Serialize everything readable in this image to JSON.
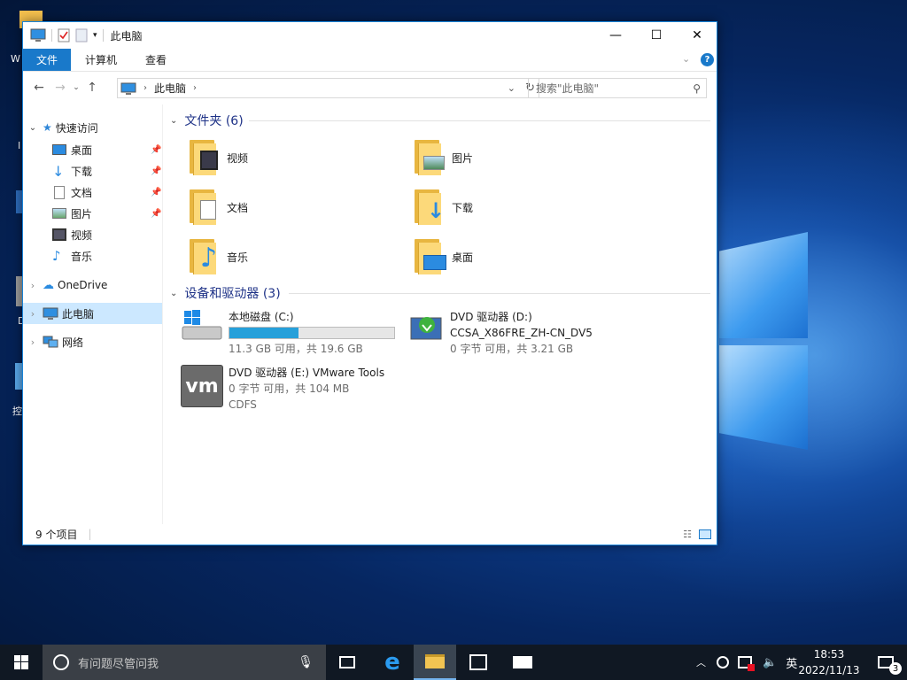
{
  "window": {
    "title": "此电脑",
    "min_glyph": "—",
    "max_glyph": "☐",
    "close_glyph": "✕"
  },
  "ribbon": {
    "tabs": [
      "文件",
      "计算机",
      "查看"
    ]
  },
  "address": {
    "path": "此电脑",
    "search_placeholder": "搜索\"此电脑\""
  },
  "sidebar": {
    "quick_access": "快速访问",
    "pinned": [
      "桌面",
      "下载",
      "文档",
      "图片"
    ],
    "unpinned": [
      "视频",
      "音乐"
    ],
    "onedrive": "OneDrive",
    "this_pc": "此电脑",
    "network": "网络"
  },
  "folders": {
    "header": "文件夹 (6)",
    "items": [
      "视频",
      "图片",
      "文档",
      "下载",
      "音乐",
      "桌面"
    ]
  },
  "devices": {
    "header": "设备和驱动器 (3)",
    "c_name": "本地磁盘 (C:)",
    "c_space": "11.3 GB 可用，共 19.6 GB",
    "c_used_fraction": 0.42,
    "d_name": "DVD 驱动器 (D:)",
    "d_label": "CCSA_X86FRE_ZH-CN_DV5",
    "d_space": "0 字节 可用，共 3.21 GB",
    "e_name": "DVD 驱动器 (E:) VMware Tools",
    "e_space": "0 字节 可用，共 104 MB",
    "e_fs": "CDFS",
    "vm_logo": "vm"
  },
  "status": {
    "count": "9 个项目"
  },
  "taskbar": {
    "search_placeholder": "有问题尽管问我",
    "ime": "英",
    "time": "18:53",
    "date": "2022/11/13",
    "notifications": "3"
  },
  "desktop": {
    "partial_labels": [
      "W",
      "I",
      "D",
      "控"
    ]
  },
  "colors": {
    "accent": "#1979ca",
    "selection": "#cce8ff",
    "drive_bar": "#26a0da",
    "taskbar": "#101823"
  }
}
